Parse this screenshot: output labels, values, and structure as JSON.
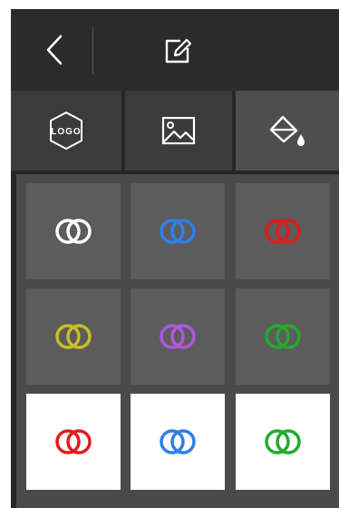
{
  "header": {
    "back_icon": "chevron-left-icon",
    "edit_icon": "edit-note-icon"
  },
  "tabs": [
    {
      "icon": "logo-badge-icon",
      "badge_text": "LOGO",
      "active": false
    },
    {
      "icon": "image-icon",
      "active": false
    },
    {
      "icon": "paint-bucket-icon",
      "active": true
    }
  ],
  "color_options": [
    {
      "icon": "overlap-circles-icon",
      "color": "#ffffff",
      "background": "dark"
    },
    {
      "icon": "overlap-circles-icon",
      "color": "#2f7fe6",
      "background": "dark"
    },
    {
      "icon": "overlap-circles-icon",
      "color": "#e01c1c",
      "background": "dark"
    },
    {
      "icon": "overlap-circles-icon",
      "color": "#c8be2a",
      "background": "dark"
    },
    {
      "icon": "overlap-circles-icon",
      "color": "#b255e0",
      "background": "dark"
    },
    {
      "icon": "overlap-circles-icon",
      "color": "#22aa2c",
      "background": "dark"
    },
    {
      "icon": "overlap-circles-icon",
      "color": "#e01c1c",
      "background": "light"
    },
    {
      "icon": "overlap-circles-icon",
      "color": "#2f7fe6",
      "background": "light"
    },
    {
      "icon": "overlap-circles-icon",
      "color": "#22aa2c",
      "background": "light"
    }
  ]
}
